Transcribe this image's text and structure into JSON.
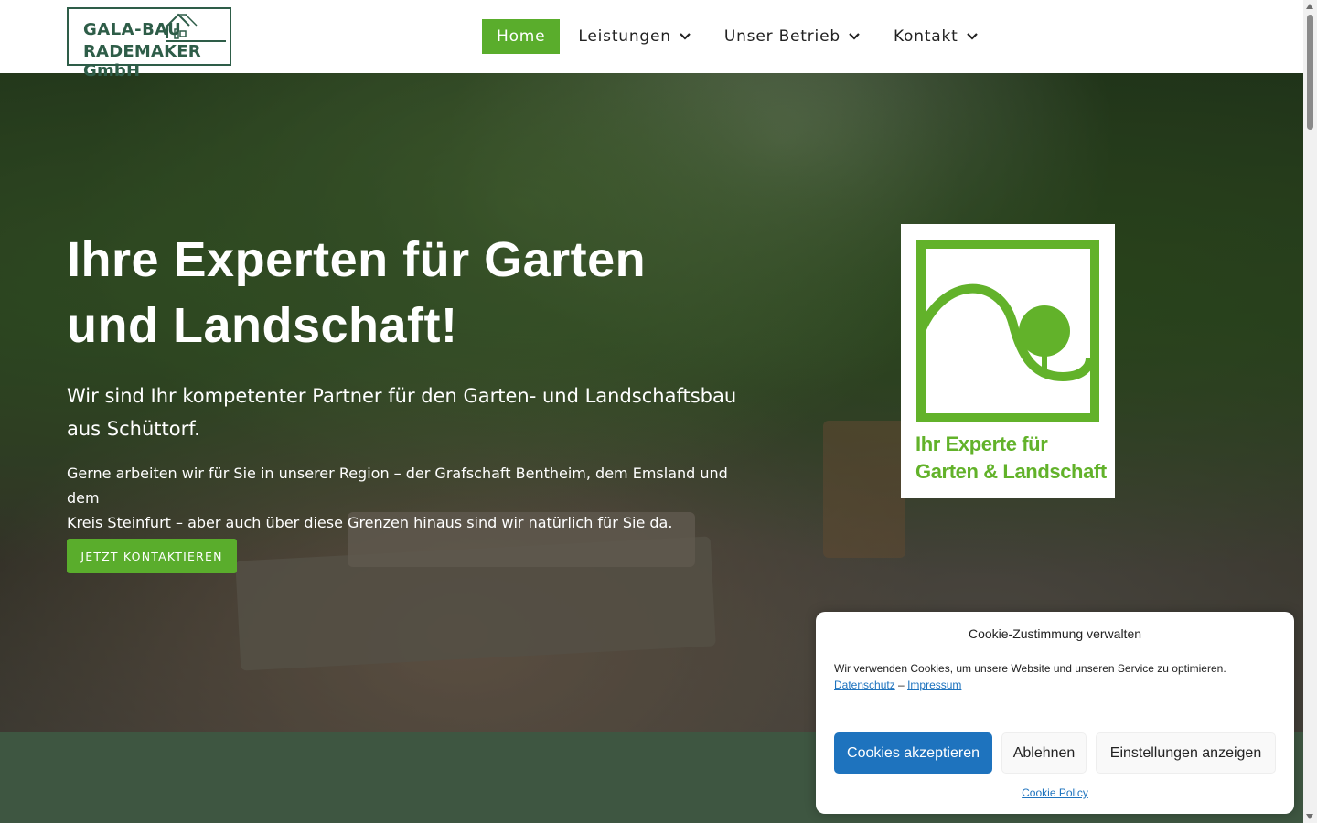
{
  "header": {
    "logo": {
      "line1": "GALA-BAU",
      "line2": "RADEMAKER GmbH",
      "brand_color": "#2e5d48"
    },
    "nav": [
      {
        "label": "Home",
        "active": true,
        "has_dropdown": false
      },
      {
        "label": "Leistungen",
        "active": false,
        "has_dropdown": true
      },
      {
        "label": "Unser Betrieb",
        "active": false,
        "has_dropdown": true
      },
      {
        "label": "Kontakt",
        "active": false,
        "has_dropdown": true
      }
    ],
    "accent_color": "#5aad2c"
  },
  "hero": {
    "title_line1": "Ihre Experten für Garten",
    "title_line2": "und Landschaft!",
    "subtitle_line1": "Wir sind Ihr kompetenter Partner für den Garten- und Landschaftsbau",
    "subtitle_line2": "aus Schüttorf.",
    "text_line1": "Gerne arbeiten wir für Sie in unserer Region – der Grafschaft Bentheim, dem Emsland und dem",
    "text_line2": "Kreis Steinfurt – aber auch über diese Grenzen hinaus sind wir natürlich für Sie da.",
    "cta_label": "JETZT KONTAKTIEREN",
    "badge": {
      "line1": "Ihr Experte für",
      "line2": "Garten & Landschaft",
      "color": "#62b22a"
    }
  },
  "cookie_banner": {
    "title": "Cookie-Zustimmung verwalten",
    "text": "Wir verwenden Cookies, um unsere Website und unseren Service zu optimieren.",
    "link_privacy": "Datenschutz",
    "link_separator": "–",
    "link_imprint": "Impressum",
    "accept_label": "Cookies akzeptieren",
    "deny_label": "Ablehnen",
    "prefs_label": "Einstellungen anzeigen",
    "policy_label": "Cookie Policy",
    "primary_color": "#1e73be"
  }
}
